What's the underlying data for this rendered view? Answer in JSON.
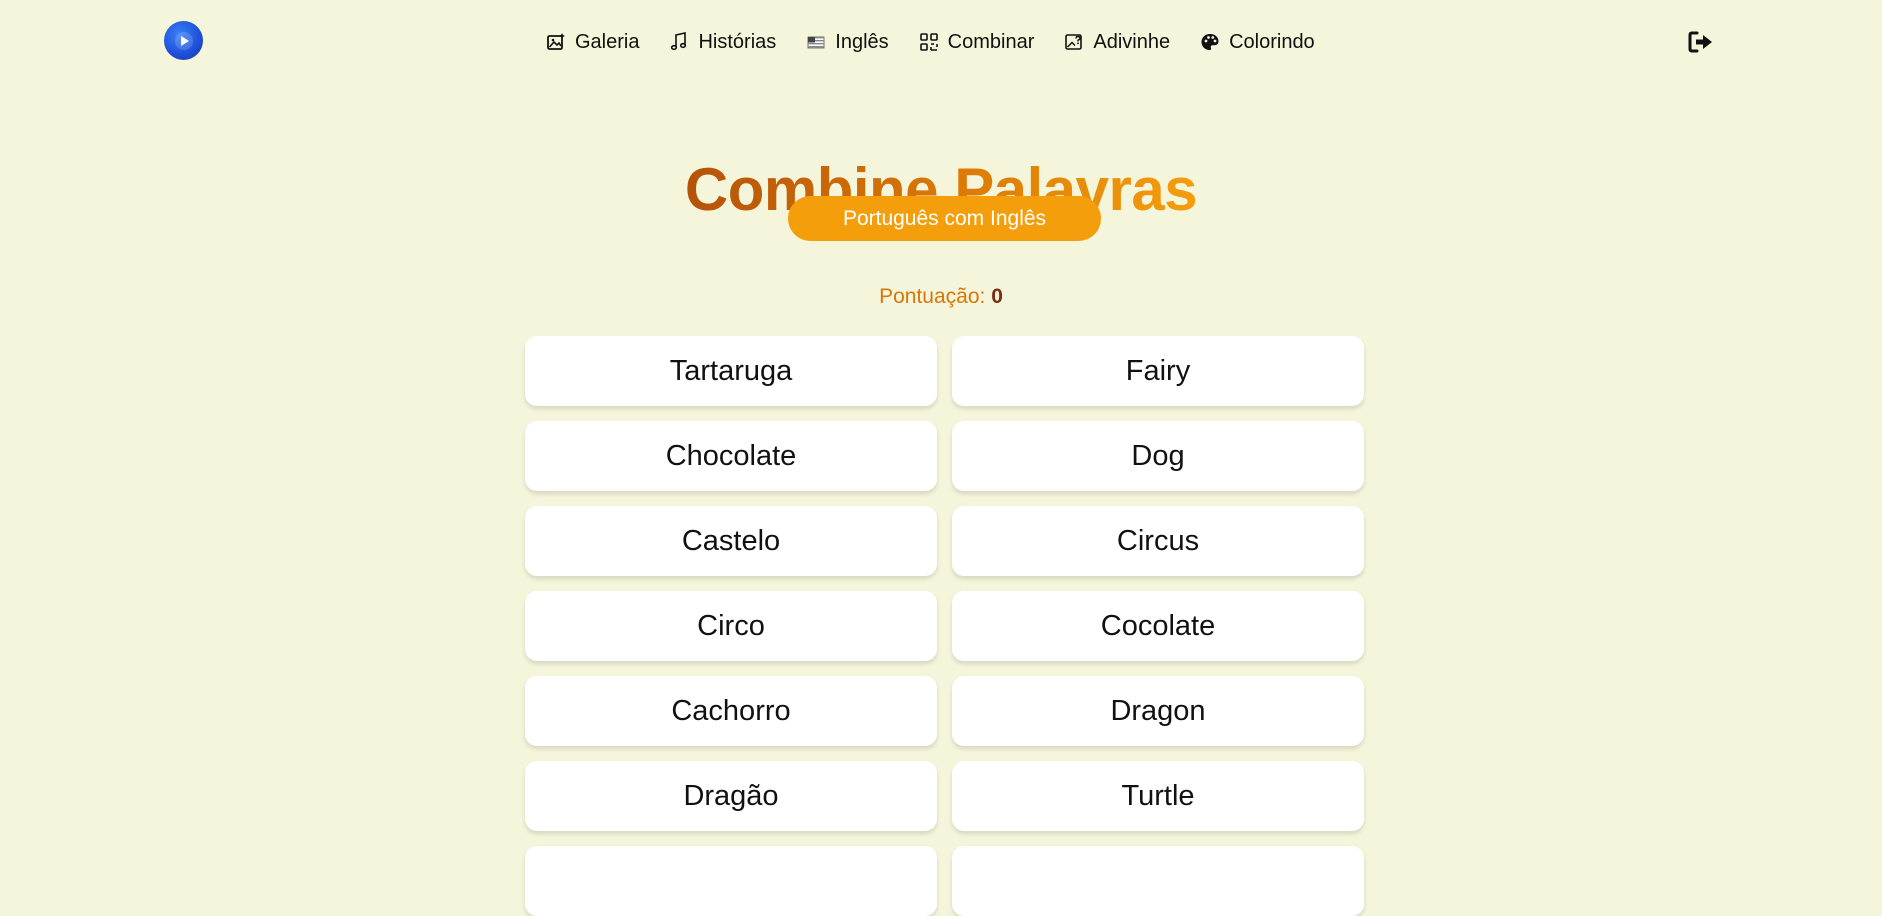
{
  "nav": {
    "items": [
      {
        "label": "Galeria",
        "icon": "image-icon"
      },
      {
        "label": "Histórias",
        "icon": "music-note-icon"
      },
      {
        "label": "Inglês",
        "icon": "us-flag-icon"
      },
      {
        "label": "Combinar",
        "icon": "qr-grid-icon"
      },
      {
        "label": "Adivinhe",
        "icon": "image-question-icon"
      },
      {
        "label": "Colorindo",
        "icon": "palette-icon"
      }
    ]
  },
  "page": {
    "title": "Combine Palavras",
    "mode": "Português com Inglês",
    "score_label": "Pontuação:",
    "score_value": "0"
  },
  "cards": {
    "left": [
      "Tartaruga",
      "Chocolate",
      "Castelo",
      "Circo",
      "Cachorro",
      "Dragão",
      ""
    ],
    "right": [
      "Fairy",
      "Dog",
      "Circus",
      "Cocolate",
      "Dragon",
      "Turtle",
      ""
    ]
  },
  "colors": {
    "background": "#f5f5dc",
    "accent": "#f59e0b",
    "title_gradient_start": "#b45309",
    "title_gradient_end": "#f59e0b",
    "logo": "#1d4ed8"
  }
}
